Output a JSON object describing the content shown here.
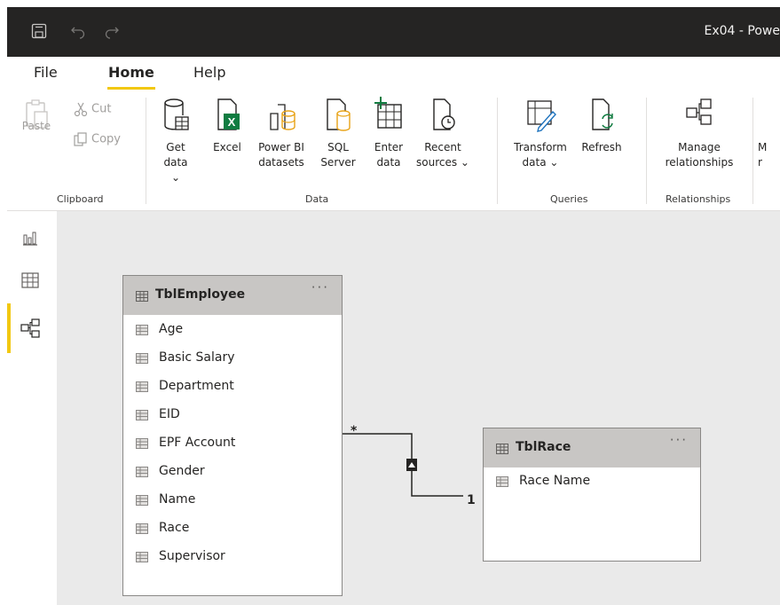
{
  "titlebar": {
    "window_title": "Ex04 - Powe",
    "save_icon": "save-icon",
    "undo_icon": "undo-icon",
    "redo_icon": "redo-icon"
  },
  "tabs": [
    {
      "label": "File",
      "active": false
    },
    {
      "label": "Home",
      "active": true
    },
    {
      "label": "Help",
      "active": false
    }
  ],
  "ribbon": {
    "clipboard": {
      "paste": "Paste",
      "cut": "Cut",
      "copy": "Copy",
      "group": "Clipboard"
    },
    "data": {
      "get_data": "Get\ndata ⌄",
      "excel": "Excel",
      "power_bi_datasets": "Power BI\ndatasets",
      "sql_server": "SQL\nServer",
      "enter_data": "Enter\ndata",
      "recent_sources": "Recent\nsources ⌄",
      "group": "Data"
    },
    "queries": {
      "transform_data": "Transform\ndata ⌄",
      "refresh": "Refresh",
      "group": "Queries"
    },
    "relationships": {
      "manage": "Manage\nrelationships",
      "group": "Relationships"
    },
    "cutoff": {
      "label": "M\nr"
    }
  },
  "leftrail": {
    "report_icon": "report-view-icon",
    "data_icon": "data-view-icon",
    "model_icon": "model-view-icon"
  },
  "tables": {
    "employee": {
      "name": "TblEmployee",
      "more": "···",
      "fields": [
        "Age",
        "Basic Salary",
        "Department",
        "EID",
        "EPF Account",
        "Gender",
        "Name",
        "Race",
        "Supervisor"
      ]
    },
    "race": {
      "name": "TblRace",
      "more": "···",
      "fields": [
        "Race Name"
      ]
    }
  },
  "relationship": {
    "many_label": "*",
    "one_label": "1",
    "direction": "single"
  },
  "colors": {
    "accent": "#f2c811",
    "titlebar": "#252423",
    "canvas": "#eaeaea",
    "table_header": "#c8c6c4"
  }
}
